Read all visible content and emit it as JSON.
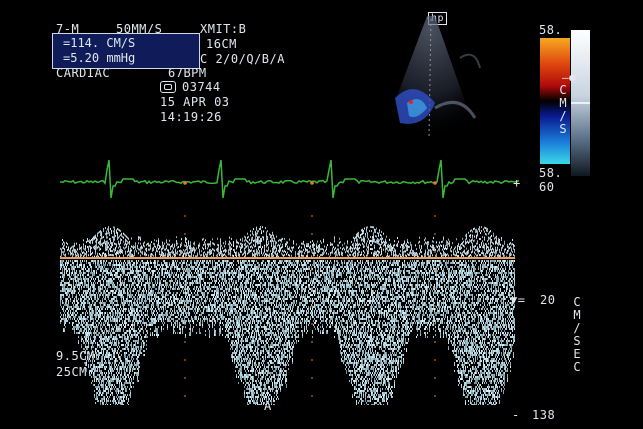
{
  "header": {
    "mode": "7-M",
    "sweep": "50MM/S",
    "xmit": "XMIT:B",
    "depth": "16CM",
    "processing": "C 2/0/Q/B/A",
    "preset": "CARDIAC",
    "heart_rate": "67BPM",
    "study_id": "03744",
    "date": "15 APR 03",
    "time": "14:19:26"
  },
  "measure_box": {
    "velocity": "=114. CM/S",
    "gradient": "=5.20 mmHg"
  },
  "probe_label": "hp",
  "color_scale": {
    "top": "58.",
    "bottom": "58.",
    "unit": "CM/S",
    "colors": [
      "#f7a820",
      "#e04a10",
      "#b00a0a",
      "#000000",
      "#0a1a90",
      "#1a7ad8",
      "#3ad8e8"
    ]
  },
  "ecg": {
    "gain_label": "60",
    "trace_color": "#3ab83a"
  },
  "spectral": {
    "gate_depth": "9.5CM",
    "scale_depth": "25CM",
    "scale_top": "20",
    "scale_bottom": "138",
    "unit": "CM/SEC",
    "baseline_color": "#e8a060",
    "marker_label": "A"
  }
}
